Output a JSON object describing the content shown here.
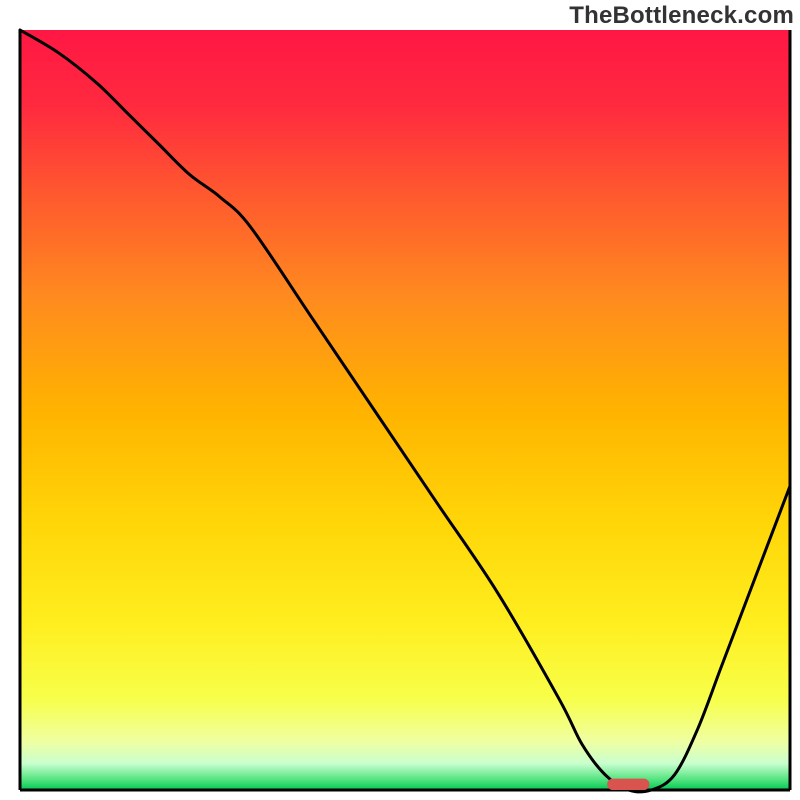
{
  "watermark": "TheBottleneck.com",
  "chart_data": {
    "type": "line",
    "title": "",
    "xlabel": "",
    "ylabel": "",
    "xlim": [
      0,
      100
    ],
    "ylim": [
      0,
      100
    ],
    "x": [
      0,
      5,
      10,
      14,
      18,
      22,
      26,
      30,
      38,
      46,
      54,
      62,
      70,
      73,
      76,
      79,
      82,
      85,
      88,
      91,
      94,
      97,
      100
    ],
    "values": [
      100,
      97,
      93,
      89,
      85,
      81,
      78,
      74,
      62,
      50,
      38,
      26,
      12,
      6,
      2,
      0,
      0,
      2,
      8,
      16,
      24,
      32,
      40
    ],
    "marker": {
      "shape": "rounded-rect",
      "x": 79,
      "y": 0,
      "width": 5.5,
      "height": 1.5,
      "color": "#d9534f"
    },
    "axes": {
      "left": true,
      "right": true,
      "top": false,
      "bottom": true,
      "grid": false
    },
    "background_gradient": {
      "stops": [
        {
          "offset": 0.0,
          "color": "#ff1744"
        },
        {
          "offset": 0.1,
          "color": "#ff2a3f"
        },
        {
          "offset": 0.22,
          "color": "#ff5a2e"
        },
        {
          "offset": 0.35,
          "color": "#ff8a1f"
        },
        {
          "offset": 0.5,
          "color": "#ffb300"
        },
        {
          "offset": 0.65,
          "color": "#ffd608"
        },
        {
          "offset": 0.78,
          "color": "#ffee1f"
        },
        {
          "offset": 0.88,
          "color": "#f7ff4a"
        },
        {
          "offset": 0.935,
          "color": "#f0ffa0"
        },
        {
          "offset": 0.965,
          "color": "#caffcf"
        },
        {
          "offset": 0.985,
          "color": "#5be585"
        },
        {
          "offset": 1.0,
          "color": "#00c853"
        }
      ]
    }
  }
}
